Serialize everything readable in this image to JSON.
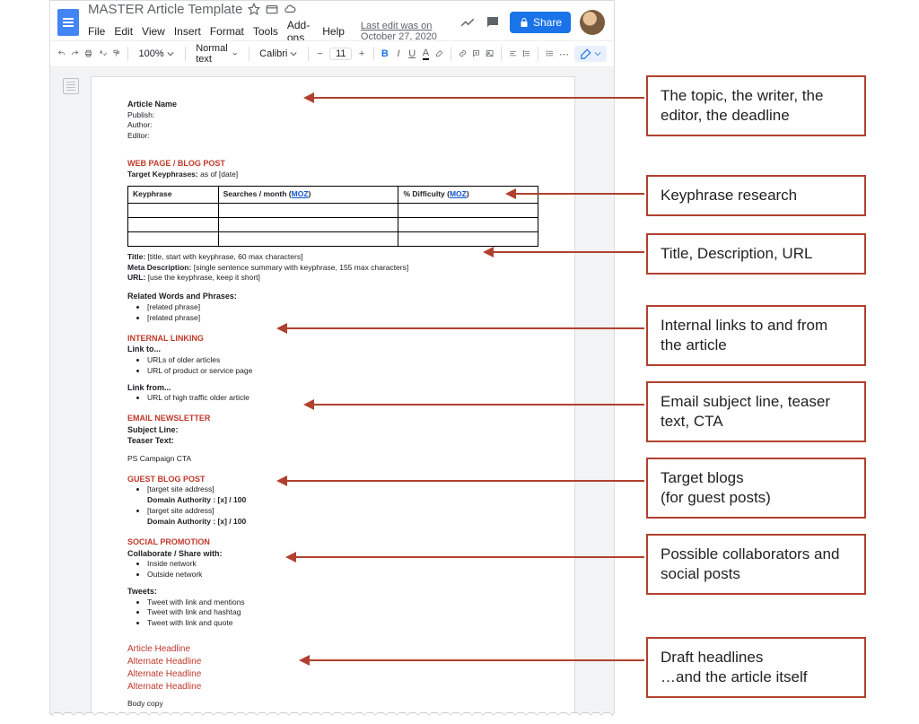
{
  "doc": {
    "title": "MASTER Article Template",
    "last_edit": "Last edit was on October 27, 2020"
  },
  "menus": {
    "file": "File",
    "edit": "Edit",
    "view": "View",
    "insert": "Insert",
    "format": "Format",
    "tools": "Tools",
    "addons": "Add-ons",
    "help": "Help"
  },
  "share_label": "Share",
  "toolbar": {
    "zoom": "100%",
    "style": "Normal text",
    "font": "Calibri",
    "size": "11"
  },
  "header": {
    "article_name": "Article Name",
    "publish": "Publish:",
    "author": "Author:",
    "editor": "Editor:"
  },
  "sec_web": {
    "heading": "WEB PAGE / BLOG POST",
    "target": "Target Keyphrases:",
    "asof": "as of [date]",
    "col1": "Keyphrase",
    "col2": "Searches / month (",
    "col3": "% Difficulty (",
    "moz": "MOZ",
    "title_l": "Title:",
    "title_v": "[title, start with keyphrase, 60 max characters]",
    "meta_l": "Meta Description:",
    "meta_v": "[single sentence summary with keyphrase, 155 max characters]",
    "url_l": "URL:",
    "url_v": "[use the keyphrase, keep it short]",
    "related": "Related Words and Phrases:",
    "rp1": "[related phrase]",
    "rp2": "[related phrase]"
  },
  "sec_internal": {
    "heading": "INTERNAL LINKING",
    "linkto": "Link to...",
    "li1": "URLs of older articles",
    "li2": "URL of product or service page",
    "linkfrom": "Link from...",
    "lf1": "URL of high traffic older article"
  },
  "sec_email": {
    "heading": "EMAIL NEWSLETTER",
    "subject": "Subject Line:",
    "teaser": "Teaser Text:",
    "ps": "PS Campaign CTA"
  },
  "sec_guest": {
    "heading": "GUEST BLOG POST",
    "t1": "[target site address]",
    "da1": "Domain Authority : [x] / 100",
    "t2": "[target site address]",
    "da2": "Domain Authority : [x] / 100"
  },
  "sec_social": {
    "heading": "SOCIAL PROMOTION",
    "collab": "Collaborate / Share with:",
    "c1": "Inside network",
    "c2": "Outside network",
    "tweets": "Tweets:",
    "tw1": "Tweet with link and mentions",
    "tw2": "Tweet with link and hashtag",
    "tw3": "Tweet with link and quote"
  },
  "sec_headline": {
    "h1": "Article Headline",
    "h2": "Alternate Headline",
    "h3": "Alternate Headline",
    "h4": "Alternate Headline",
    "body": "Body copy"
  },
  "annotations": {
    "a1": "The topic, the writer, the editor, the deadline",
    "a2": "Keyphrase research",
    "a3": "Title, Description, URL",
    "a4": "Internal links to and from the article",
    "a5": "Email subject line, teaser text, CTA",
    "a6": "Target blogs\n(for guest posts)",
    "a7": "Possible collaborators and social posts",
    "a8": "Draft headlines\n…and the article itself"
  }
}
